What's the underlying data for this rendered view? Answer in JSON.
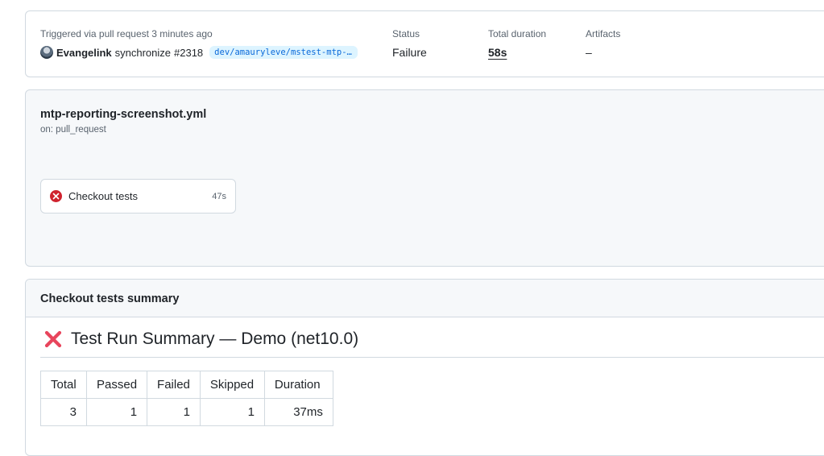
{
  "run": {
    "trigger_text": "Triggered via pull request 3 minutes ago",
    "actor": "Evangelink",
    "event": "synchronize",
    "pr_number": "#2318",
    "branch": "dev/amauryleve/mstest-mtp-b…",
    "status_label": "Status",
    "status_value": "Failure",
    "duration_label": "Total duration",
    "duration_value": "58s",
    "artifacts_label": "Artifacts",
    "artifacts_value": "–"
  },
  "workflow": {
    "file_name": "mtp-reporting-screenshot.yml",
    "trigger": "on: pull_request",
    "jobs": [
      {
        "name": "Checkout tests",
        "duration": "47s",
        "status": "failure",
        "status_icon": "x-circle-icon"
      }
    ]
  },
  "summary": {
    "header": "Checkout tests summary",
    "heading_icon": "cross-mark-icon",
    "heading": "Test Run Summary — Demo (net10.0)",
    "table": {
      "headers": [
        "Total",
        "Passed",
        "Failed",
        "Skipped",
        "Duration"
      ],
      "rows": [
        [
          "3",
          "1",
          "1",
          "1",
          "37ms"
        ]
      ]
    }
  },
  "colors": {
    "failure_red": "#cf222e",
    "cross_red": "#e8455c",
    "branch_bg": "#ddf4ff",
    "branch_fg": "#0969da",
    "border": "#d1d9e0",
    "muted_bg": "#f6f8fa"
  }
}
